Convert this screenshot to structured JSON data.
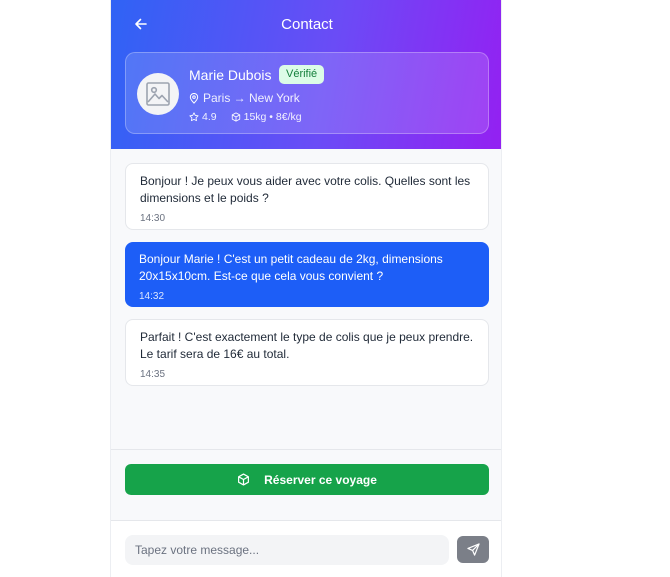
{
  "header": {
    "title": "Contact",
    "back_icon": "arrow-left-icon"
  },
  "contact": {
    "name": "Marie Dubois",
    "badge": "Vérifié",
    "route": "Paris → New York",
    "rating": "4.9",
    "capacity": "15kg • 8€/kg",
    "avatar_icon": "image-placeholder-icon"
  },
  "messages": [
    {
      "direction": "incoming",
      "text": "Bonjour ! Je peux vous aider avec votre colis. Quelles sont les dimensions et le poids ?",
      "time": "14:30"
    },
    {
      "direction": "outgoing",
      "text": "Bonjour Marie ! C'est un petit cadeau de 2kg, dimensions 20x15x10cm. Est-ce que cela vous convient ?",
      "time": "14:32"
    },
    {
      "direction": "incoming",
      "text": "Parfait ! C'est exactement le type de colis que je peux prendre. Le tarif sera de 16€ au total.",
      "time": "14:35"
    }
  ],
  "actions": {
    "reserve_label": "Réserver ce voyage",
    "reserve_icon": "package-icon"
  },
  "composer": {
    "placeholder": "Tapez votre message...",
    "send_icon": "send-icon"
  },
  "colors": {
    "header_gradient_start": "#2f63f5",
    "header_gradient_end": "#9420f2",
    "outgoing_bubble": "#1d5ef7",
    "reserve_button": "#16a34a",
    "badge_bg": "#dcfce7",
    "badge_text": "#15803d"
  }
}
